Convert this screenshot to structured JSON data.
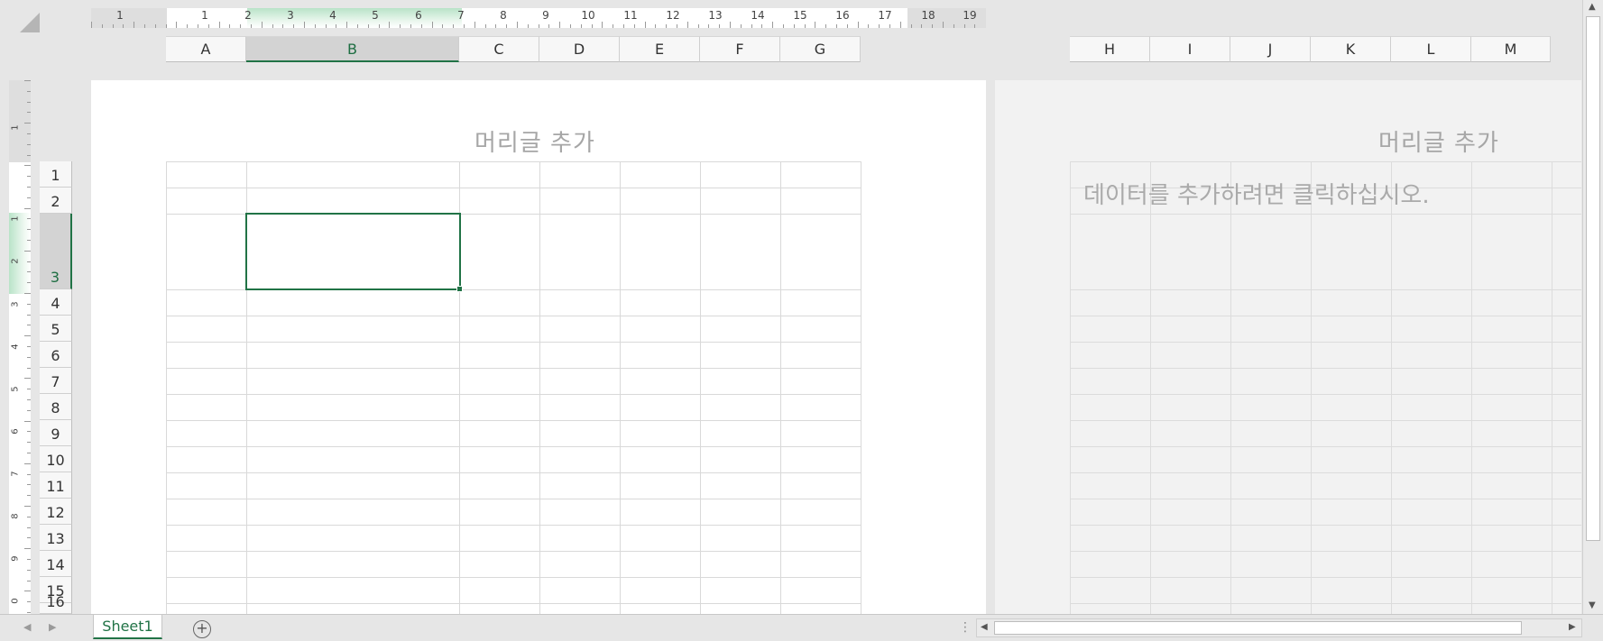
{
  "ruler": {
    "horizontal_numbers": [
      "1",
      "1",
      "2",
      "3",
      "4",
      "5",
      "6",
      "7",
      "8",
      "9",
      "10",
      "11",
      "12",
      "13",
      "14",
      "15",
      "16",
      "17",
      "18",
      "19"
    ],
    "vertical_numbers": [
      "1",
      "1",
      "2",
      "3",
      "4",
      "5",
      "6",
      "7",
      "8",
      "9",
      "0"
    ]
  },
  "columns_left": [
    "A",
    "B",
    "C",
    "D",
    "E",
    "F",
    "G"
  ],
  "columns_right": [
    "H",
    "I",
    "J",
    "K",
    "L",
    "M"
  ],
  "active_column": "B",
  "rows": [
    "1",
    "2",
    "3",
    "4",
    "5",
    "6",
    "7",
    "8",
    "9",
    "10",
    "11",
    "12",
    "13",
    "14",
    "15",
    "16"
  ],
  "active_row": "3",
  "page1": {
    "header": "머리글 추가"
  },
  "page2": {
    "header": "머리글 추가",
    "hint": "데이터를 추가하려면 클릭하십시오."
  },
  "sheet_tabs": [
    {
      "name": "Sheet1",
      "active": true
    }
  ],
  "icons": {
    "select_all": "select-all-triangle",
    "add_sheet": "plus-circle-icon",
    "nav_prev": "triangle-left-icon",
    "nav_next": "triangle-right-icon"
  },
  "colors": {
    "accent": "#217346"
  }
}
